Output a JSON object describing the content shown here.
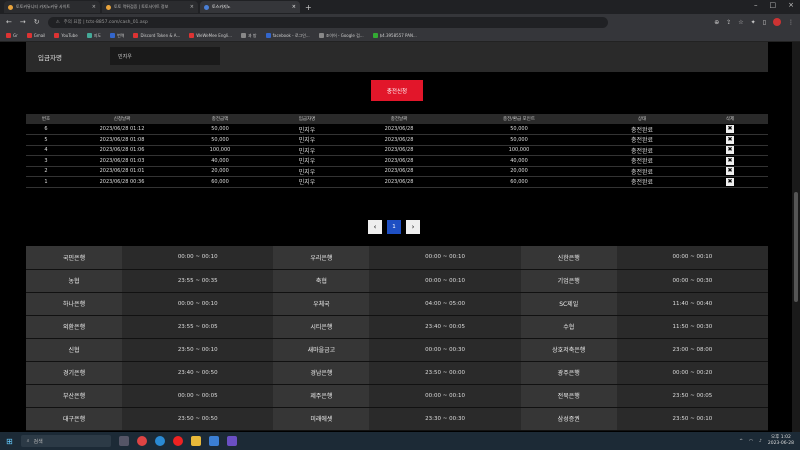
{
  "browser": {
    "tabs": [
      {
        "title": "토토커뮤니티 카지노커뮤 사이트",
        "color": "#e8a33c"
      },
      {
        "title": "토토 먹튀검증 | 토토사이트 정보",
        "color": "#e8a33c"
      },
      {
        "title": "토스카지노",
        "color": "#4a7fd6"
      }
    ],
    "url": "주의 요함 | tcts-8857.com/cash_01.asp",
    "bookmarks": [
      {
        "label": "Gr",
        "color": "#d33"
      },
      {
        "label": "Gmail",
        "color": "#d33"
      },
      {
        "label": "YouTube",
        "color": "#d33"
      },
      {
        "label": "지도",
        "color": "#4a9"
      },
      {
        "label": "번역",
        "color": "#36c"
      },
      {
        "label": "Discord Token & A...",
        "color": "#d33"
      },
      {
        "label": "WeWeMee Engli...",
        "color": "#d33"
      },
      {
        "label": "과 방",
        "color": "#888"
      },
      {
        "label": "facebook - 로그인...",
        "color": "#36c"
      },
      {
        "label": "조이어 - Google 검...",
        "color": "#888"
      },
      {
        "label": "$4.3958557 PAN...",
        "color": "#3a3"
      }
    ]
  },
  "deposit_form": {
    "label": "입금자명",
    "value": "민지우",
    "apply_button": "충전신청"
  },
  "history": {
    "headers": [
      "번호",
      "신청날짜",
      "충전금액",
      "입금자명",
      "충전날짜",
      "충전/환급 포인트",
      "상태",
      "삭제"
    ],
    "rows": [
      {
        "no": "6",
        "date": "2023/06/28 01:12",
        "amount": "50,000",
        "name": "민지우",
        "charge_date": "2023/06/28",
        "points": "50,000",
        "status": "충전완료"
      },
      {
        "no": "5",
        "date": "2023/06/28 01:08",
        "amount": "50,000",
        "name": "민지우",
        "charge_date": "2023/06/28",
        "points": "50,000",
        "status": "충전완료"
      },
      {
        "no": "4",
        "date": "2023/06/28 01:06",
        "amount": "100,000",
        "name": "민지우",
        "charge_date": "2023/06/28",
        "points": "100,000",
        "status": "충전완료"
      },
      {
        "no": "3",
        "date": "2023/06/28 01:03",
        "amount": "40,000",
        "name": "민지우",
        "charge_date": "2023/06/28",
        "points": "40,000",
        "status": "충전완료"
      },
      {
        "no": "2",
        "date": "2023/06/28 01:01",
        "amount": "20,000",
        "name": "민지우",
        "charge_date": "2023/06/28",
        "points": "20,000",
        "status": "충전완료"
      },
      {
        "no": "1",
        "date": "2023/06/28 00:36",
        "amount": "60,000",
        "name": "민지우",
        "charge_date": "2023/06/28",
        "points": "60,000",
        "status": "충전완료"
      }
    ],
    "delete_glyph": "✖"
  },
  "pagination": {
    "prev": "‹",
    "current": "1",
    "next": "›"
  },
  "bank_hours": [
    [
      {
        "bank": "국민은행",
        "hours": "00:00 ~ 00:10"
      },
      {
        "bank": "우리은행",
        "hours": "00:00 ~ 00:10"
      },
      {
        "bank": "신한은행",
        "hours": "00:00 ~ 00:10"
      }
    ],
    [
      {
        "bank": "농협",
        "hours": "23:55 ~ 00:35"
      },
      {
        "bank": "축협",
        "hours": "00:00 ~ 00:10"
      },
      {
        "bank": "기업은행",
        "hours": "00:00 ~ 00:30"
      }
    ],
    [
      {
        "bank": "하나은행",
        "hours": "00:00 ~ 00:10"
      },
      {
        "bank": "우체국",
        "hours": "04:00 ~ 05:00"
      },
      {
        "bank": "SC제일",
        "hours": "11:40 ~ 00:40"
      }
    ],
    [
      {
        "bank": "외환은행",
        "hours": "23:55 ~ 00:05"
      },
      {
        "bank": "시티은행",
        "hours": "23:40 ~ 00:05"
      },
      {
        "bank": "수협",
        "hours": "11:50 ~ 00:30"
      }
    ],
    [
      {
        "bank": "신협",
        "hours": "23:50 ~ 00:10"
      },
      {
        "bank": "새마을금고",
        "hours": "00:00 ~ 00:30"
      },
      {
        "bank": "상호저축은행",
        "hours": "23:00 ~ 08:00"
      }
    ],
    [
      {
        "bank": "경기은행",
        "hours": "23:40 ~ 00:50"
      },
      {
        "bank": "경남은행",
        "hours": "23:50 ~ 00:00"
      },
      {
        "bank": "광주은행",
        "hours": "00:00 ~ 00:20"
      }
    ],
    [
      {
        "bank": "부산은행",
        "hours": "00:00 ~ 00:05"
      },
      {
        "bank": "제주은행",
        "hours": "00:00 ~ 00:10"
      },
      {
        "bank": "전북은행",
        "hours": "23:50 ~ 00:05"
      }
    ],
    [
      {
        "bank": "대구은행",
        "hours": "23:50 ~ 00:50"
      },
      {
        "bank": "미래에셋",
        "hours": "23:30 ~ 00:30"
      },
      {
        "bank": "삼성증권",
        "hours": "23:50 ~ 00:10"
      }
    ]
  ],
  "taskbar": {
    "search": "검색",
    "time": "오후 1:02",
    "date": "2023-06-28"
  }
}
